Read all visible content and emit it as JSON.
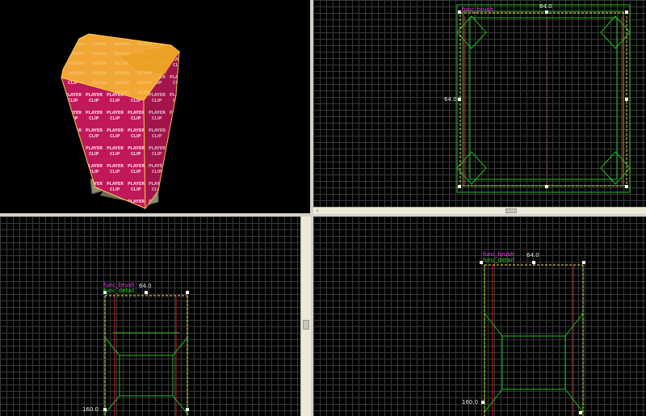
{
  "viewports": {
    "top": {
      "entity_class": "func_brush",
      "entity_sub": "func_brush",
      "width_label": "64.0",
      "height_label": "64.0"
    },
    "front": {
      "entity_class": "func_brush",
      "entity_sub": "func_detail",
      "width_label": "64.0",
      "height_label": "160.0"
    },
    "side": {
      "entity_class": "func_brush",
      "entity_sub": "func_detail",
      "width_label": "64.0",
      "height_label": "160.0"
    },
    "camera": {
      "texture_main": "PLAYER CLIP",
      "texture_top": "NODRAW"
    }
  },
  "scrollbar": {
    "left_arrow": "‹"
  },
  "colors": {
    "selection": "#ffe060",
    "brush_green": "#22c022",
    "brush_red": "#d02020",
    "label_magenta": "#ff40ff"
  }
}
